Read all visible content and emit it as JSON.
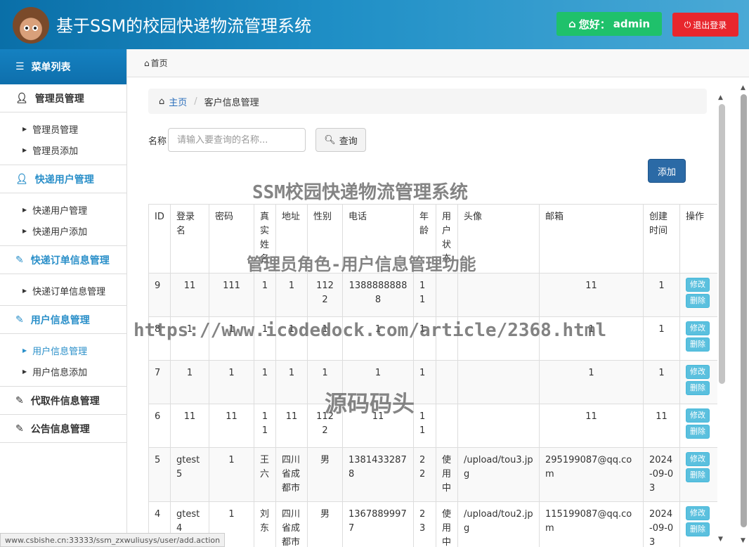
{
  "header": {
    "title": "基于SSM的校园快递物流管理系统",
    "greeting": "您好：",
    "username": "admin",
    "logout_label": "退出登录"
  },
  "sidebar": {
    "heading": "菜单列表",
    "groups": [
      {
        "label": "管理员管理",
        "items": [
          "管理员管理",
          "管理员添加"
        ]
      },
      {
        "label": "快递用户管理",
        "items": [
          "快递用户管理",
          "快递用户添加"
        ]
      },
      {
        "label": "快递订单信息管理",
        "items": [
          "快递订单信息管理"
        ]
      },
      {
        "label": "用户信息管理",
        "items": [
          "用户信息管理",
          "用户信息添加"
        ]
      },
      {
        "label": "代取件信息管理",
        "items": []
      },
      {
        "label": "公告信息管理",
        "items": []
      }
    ]
  },
  "topbar": {
    "home": "首页"
  },
  "breadcrumb": {
    "home": "主页",
    "current": "客户信息管理"
  },
  "search": {
    "label": "名称",
    "placeholder": "请输入要查询的名称...",
    "button": "查询"
  },
  "add_label": "添加",
  "table": {
    "columns": [
      "ID",
      "登录名",
      "密码",
      "真实姓名",
      "地址",
      "性别",
      "电话",
      "年龄",
      "用户状态",
      "头像",
      "邮箱",
      "创建时间",
      "操作"
    ],
    "edit_label": "修改",
    "delete_label": "删除",
    "rows": [
      {
        "id": "9",
        "login": "11",
        "pwd": "111",
        "name": "1",
        "addr": "1",
        "sex": "1122",
        "phone": "13888888888",
        "age": "11",
        "state": "",
        "avatar": "",
        "email": "11",
        "created": "1"
      },
      {
        "id": "8",
        "login": "1",
        "pwd": "1",
        "name": "1",
        "addr": "1",
        "sex": "1",
        "phone": "1",
        "age": "1",
        "state": "",
        "avatar": "",
        "email": "1",
        "created": "1"
      },
      {
        "id": "7",
        "login": "1",
        "pwd": "1",
        "name": "1",
        "addr": "1",
        "sex": "1",
        "phone": "1",
        "age": "1",
        "state": "",
        "avatar": "",
        "email": "1",
        "created": "1"
      },
      {
        "id": "6",
        "login": "11",
        "pwd": "11",
        "name": "11",
        "addr": "11",
        "sex": "1122",
        "phone": "11",
        "age": "11",
        "state": "",
        "avatar": "",
        "email": "11",
        "created": "11"
      },
      {
        "id": "5",
        "login": "gtest5",
        "pwd": "1",
        "name": "王六",
        "addr": "四川省成都市",
        "sex": "男",
        "phone": "13814332878",
        "age": "22",
        "state": "使用中",
        "avatar": "/upload/tou3.jpg",
        "email": "295199087@qq.com",
        "created": "2024-09-03"
      },
      {
        "id": "4",
        "login": "gtest4",
        "pwd": "1",
        "name": "刘东",
        "addr": "四川省成都市",
        "sex": "男",
        "phone": "13678899977",
        "age": "23",
        "state": "使用中",
        "avatar": "/upload/tou2.jpg",
        "email": "115199087@qq.com",
        "created": "2024-09-03"
      }
    ]
  },
  "watermarks": [
    "SSM校园快递物流管理系统",
    "管理员角色-用户信息管理功能",
    "https://www.icodedock.com/article/2368.html",
    "源码码头"
  ],
  "status_url": "www.csbishe.cn:33333/ssm_zxwuliusys/user/add.action"
}
